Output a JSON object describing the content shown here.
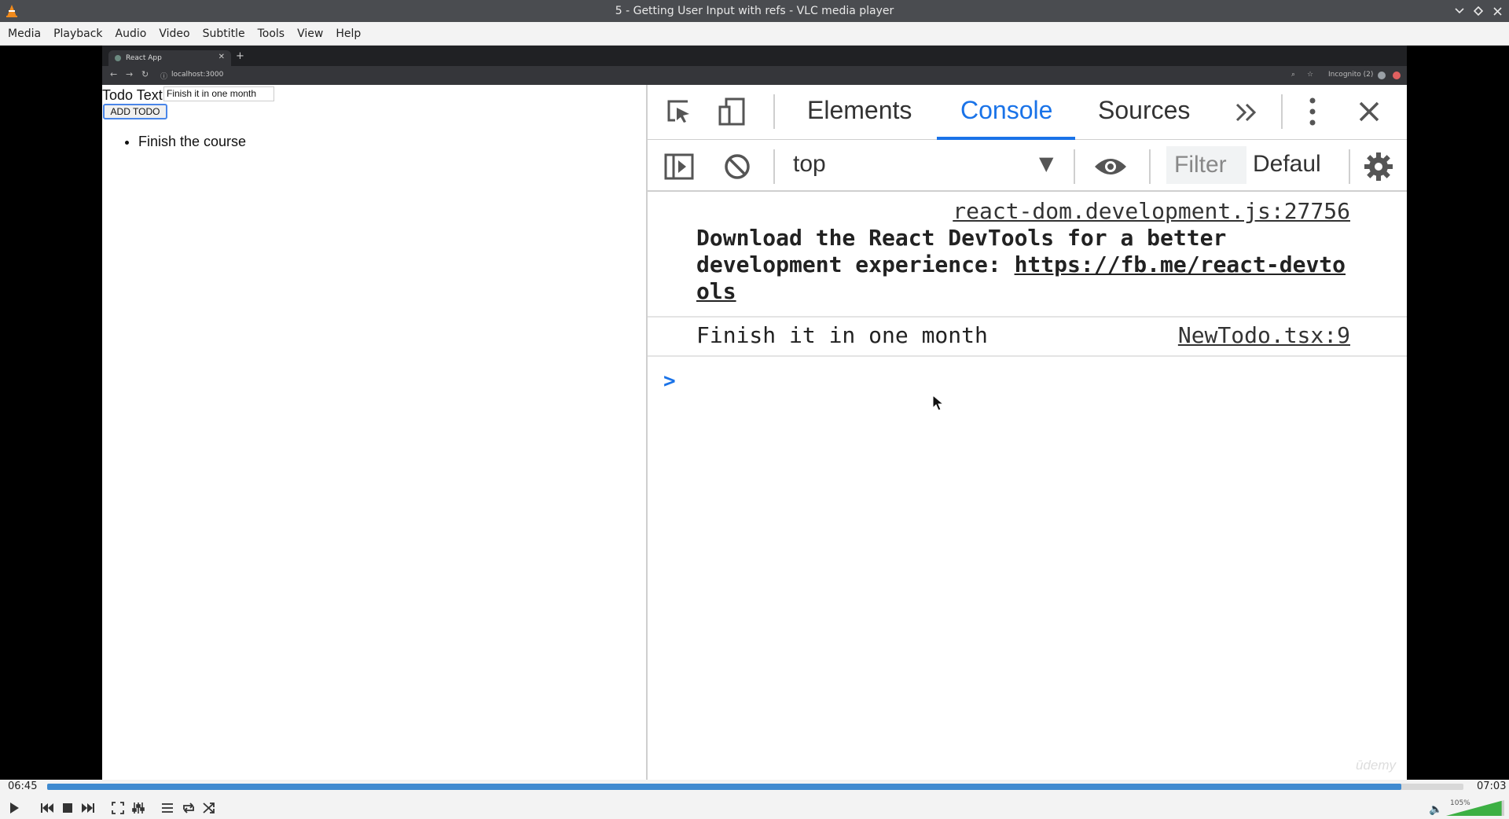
{
  "window": {
    "title": "5 - Getting User Input with refs - VLC media player"
  },
  "menu": [
    "Media",
    "Playback",
    "Audio",
    "Video",
    "Subtitle",
    "Tools",
    "View",
    "Help"
  ],
  "browser": {
    "tab_title": "React App",
    "url": "localhost:3000",
    "profile_label": "Incognito (2)"
  },
  "app": {
    "label": "Todo Text",
    "input_value": "Finish it in one month",
    "button_label": "ADD TODO",
    "todos": [
      "Finish the course"
    ]
  },
  "devtools": {
    "tabs": [
      "Elements",
      "Console",
      "Sources"
    ],
    "active_tab": "Console",
    "context": "top",
    "filter_placeholder": "Filter",
    "levels_label": "Defaul",
    "messages": [
      {
        "source": "react-dom.development.js:27756",
        "line1": "Download the React DevTools for a better",
        "line2_prefix": "development experience: ",
        "line2_link": "https://fb.me/react-devto",
        "line3_link": "ols"
      },
      {
        "source": "NewTodo.tsx:9",
        "text": "Finish it in one month"
      }
    ]
  },
  "watermark": "ūdemy",
  "player": {
    "elapsed": "06:45",
    "total": "07:03",
    "progress": 0.956,
    "volume_label": "105%",
    "volume": 1.05
  },
  "colors": {
    "accent": "#1a73e8",
    "seek": "#3f8ad0",
    "volume": "#3cb043"
  }
}
